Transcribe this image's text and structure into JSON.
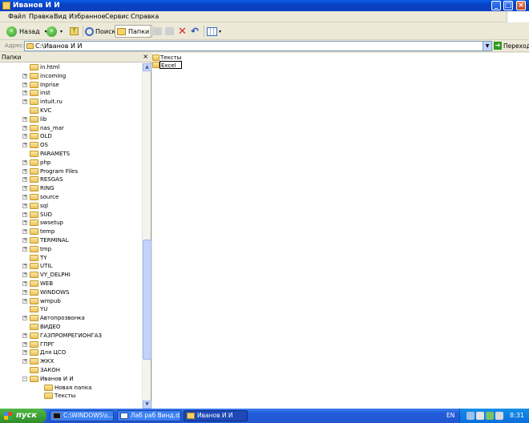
{
  "window": {
    "title": "Иванов И И"
  },
  "menu": [
    "Файл",
    "Правка",
    "Вид",
    "Избранное",
    "Сервис",
    "Справка"
  ],
  "toolbar": {
    "back_label": "Назад",
    "search_label": "Поиск",
    "folders_label": "Папки"
  },
  "address": {
    "label": "Адрес:",
    "value": "C:\\Иванов И И",
    "go_label": "Переход"
  },
  "folders_pane": {
    "title": "Папки",
    "tree": [
      {
        "label": "in.html",
        "expander": ""
      },
      {
        "label": "incoming",
        "expander": "+"
      },
      {
        "label": "Inprise",
        "expander": "+"
      },
      {
        "label": "inst",
        "expander": "+"
      },
      {
        "label": "intuit.ru",
        "expander": "+"
      },
      {
        "label": "KVC",
        "expander": ""
      },
      {
        "label": "lib",
        "expander": "+"
      },
      {
        "label": "nas_mar",
        "expander": "+"
      },
      {
        "label": "OLD",
        "expander": "+"
      },
      {
        "label": "OS",
        "expander": "+"
      },
      {
        "label": "PARAMETS",
        "expander": ""
      },
      {
        "label": "php",
        "expander": "+"
      },
      {
        "label": "Program Files",
        "expander": "+"
      },
      {
        "label": "RESGAS",
        "expander": "+"
      },
      {
        "label": "RING",
        "expander": "+"
      },
      {
        "label": "source",
        "expander": "+"
      },
      {
        "label": "sql",
        "expander": "+"
      },
      {
        "label": "SUD",
        "expander": "+"
      },
      {
        "label": "swsetup",
        "expander": "+"
      },
      {
        "label": "temp",
        "expander": "+"
      },
      {
        "label": "TERMINAL",
        "expander": "+"
      },
      {
        "label": "tmp",
        "expander": "+"
      },
      {
        "label": "TY",
        "expander": ""
      },
      {
        "label": "UTIL",
        "expander": "+"
      },
      {
        "label": "VY_DELPHI",
        "expander": "+"
      },
      {
        "label": "WEB",
        "expander": "+"
      },
      {
        "label": "WINDOWS",
        "expander": "+"
      },
      {
        "label": "wmpub",
        "expander": "+"
      },
      {
        "label": "YU",
        "expander": ""
      },
      {
        "label": "Автопрозвонка",
        "expander": "+"
      },
      {
        "label": "ВИДЕО",
        "expander": ""
      },
      {
        "label": "ГАЗПРОМРЕГИОНГАЗ",
        "expander": "+"
      },
      {
        "label": "ГПРГ",
        "expander": "+"
      },
      {
        "label": "Для ЦСО",
        "expander": "+"
      },
      {
        "label": "ЖКХ",
        "expander": "+"
      },
      {
        "label": "ЗАКОН",
        "expander": ""
      },
      {
        "label": "Иванов И И",
        "expander": "-"
      },
      {
        "label": "Новая папка",
        "expander": "",
        "child": true
      },
      {
        "label": "Тексты",
        "expander": "",
        "child": true
      }
    ]
  },
  "content": {
    "items": [
      {
        "label": "Тексты"
      },
      {
        "label": "Excel"
      }
    ]
  },
  "taskbar": {
    "start_label": "пуск",
    "tasks": [
      {
        "label": "C:\\WINDOWS\\s..."
      },
      {
        "label": "Лаб раб Винд.d..."
      },
      {
        "label": "Иванов И И"
      }
    ],
    "language": "EN",
    "clock": "8:31"
  }
}
